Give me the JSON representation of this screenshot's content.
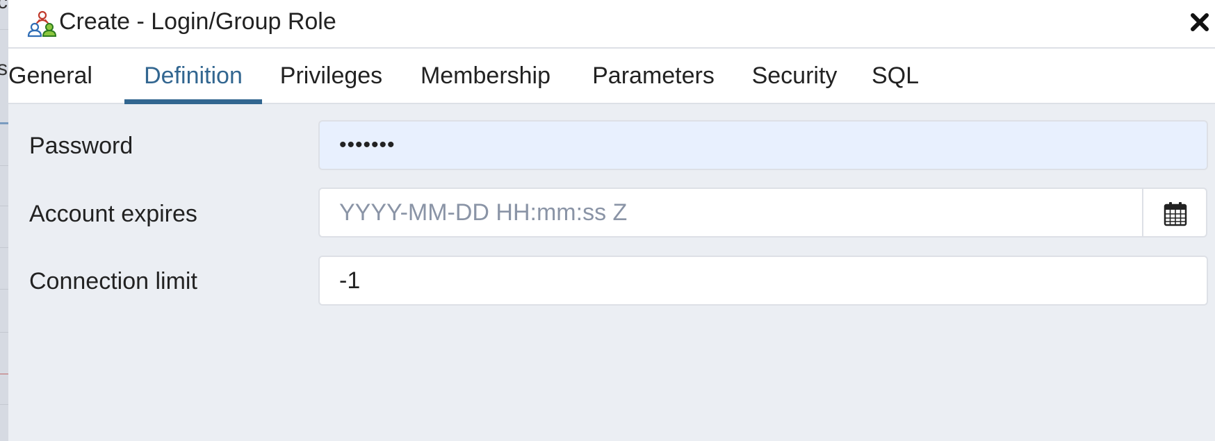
{
  "dialog": {
    "title": "Create - Login/Group Role",
    "title_icon": "role-group-icon",
    "close_icon": "close-icon"
  },
  "tabs": [
    {
      "label": "General",
      "active": false
    },
    {
      "label": "Definition",
      "active": true
    },
    {
      "label": "Privileges",
      "active": false
    },
    {
      "label": "Membership",
      "active": false
    },
    {
      "label": "Parameters",
      "active": false
    },
    {
      "label": "Security",
      "active": false
    },
    {
      "label": "SQL",
      "active": false
    }
  ],
  "form": {
    "password": {
      "label": "Password",
      "value": "•••••••"
    },
    "account_expires": {
      "label": "Account expires",
      "value": "",
      "placeholder": "YYYY-MM-DD HH:mm:ss Z",
      "icon": "calendar-icon"
    },
    "connection_limit": {
      "label": "Connection limit",
      "value": "-1"
    }
  },
  "colors": {
    "accent": "#326690",
    "autofill_bg": "#e8f0fe",
    "dialog_bg": "#ebeef3"
  }
}
